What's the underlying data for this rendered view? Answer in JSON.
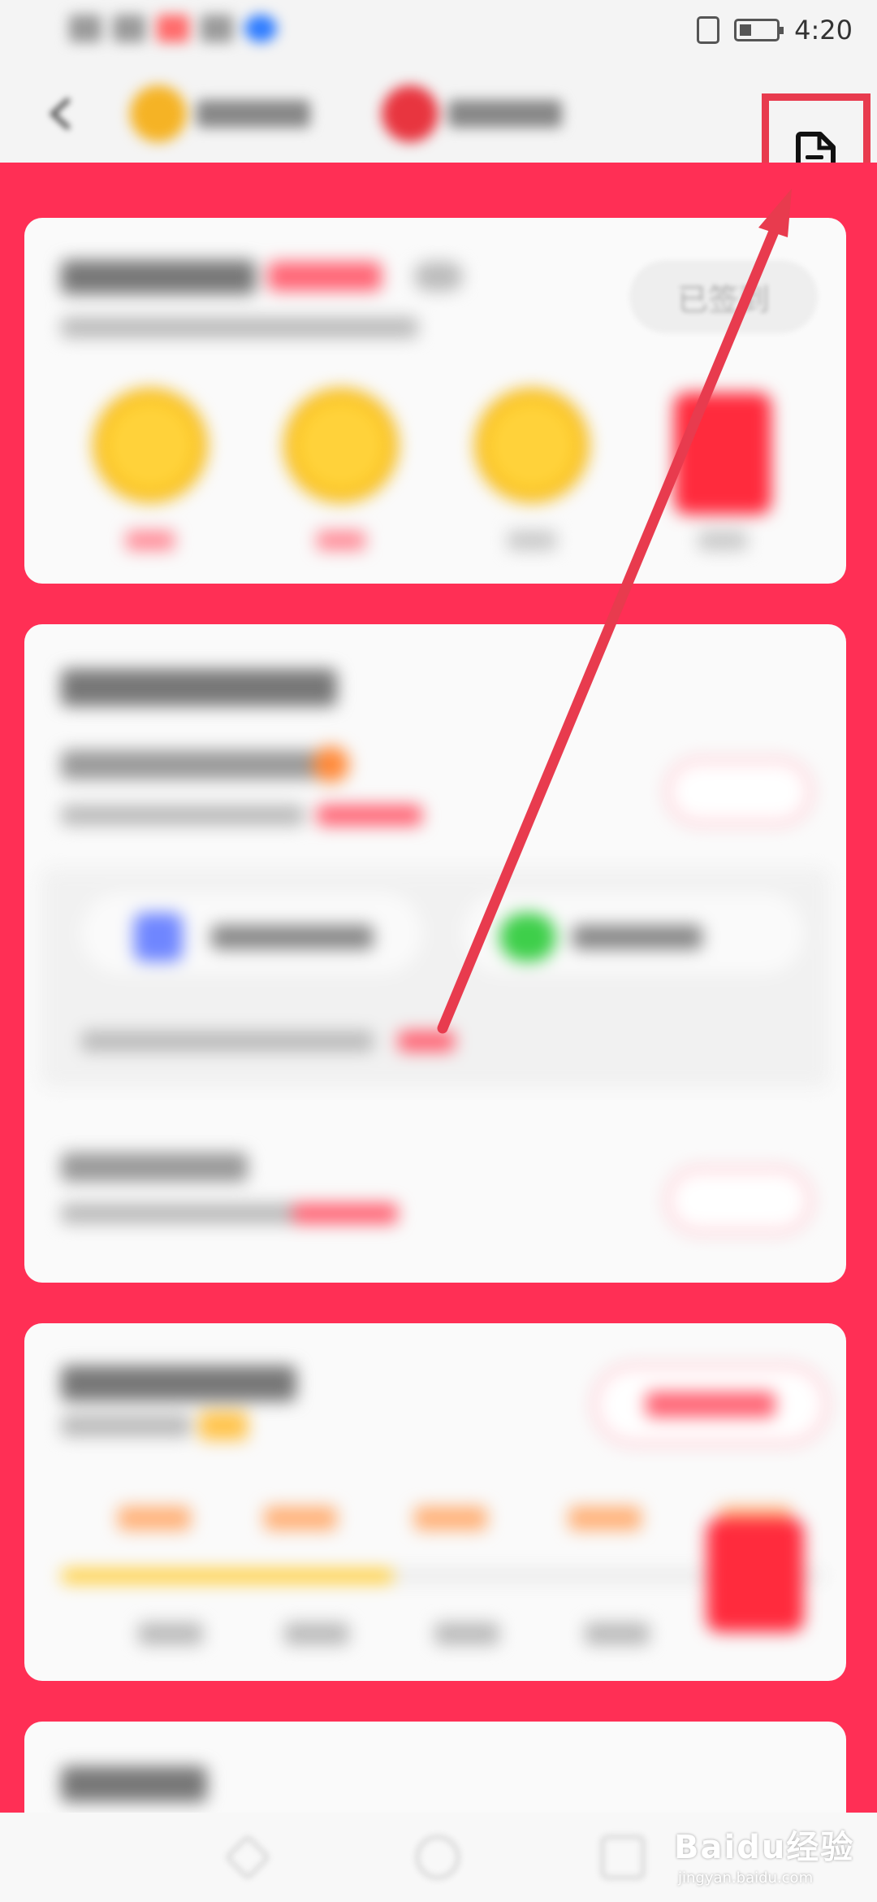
{
  "status_bar": {
    "time": "4:20"
  },
  "header": {
    "back_icon": "arrow-left-icon",
    "document_icon": "document-icon",
    "highlight_color": "#e83b4e"
  },
  "signin_card": {
    "signed_button_label": "已签到"
  },
  "watermark": {
    "brand": "Baidu经验",
    "url": "jingyan.baidu.com"
  },
  "colors": {
    "page_red": "#ff2f55",
    "card_bg": "#fafafa",
    "arrow": "#e83b4e",
    "coin": "#ffd23a"
  }
}
